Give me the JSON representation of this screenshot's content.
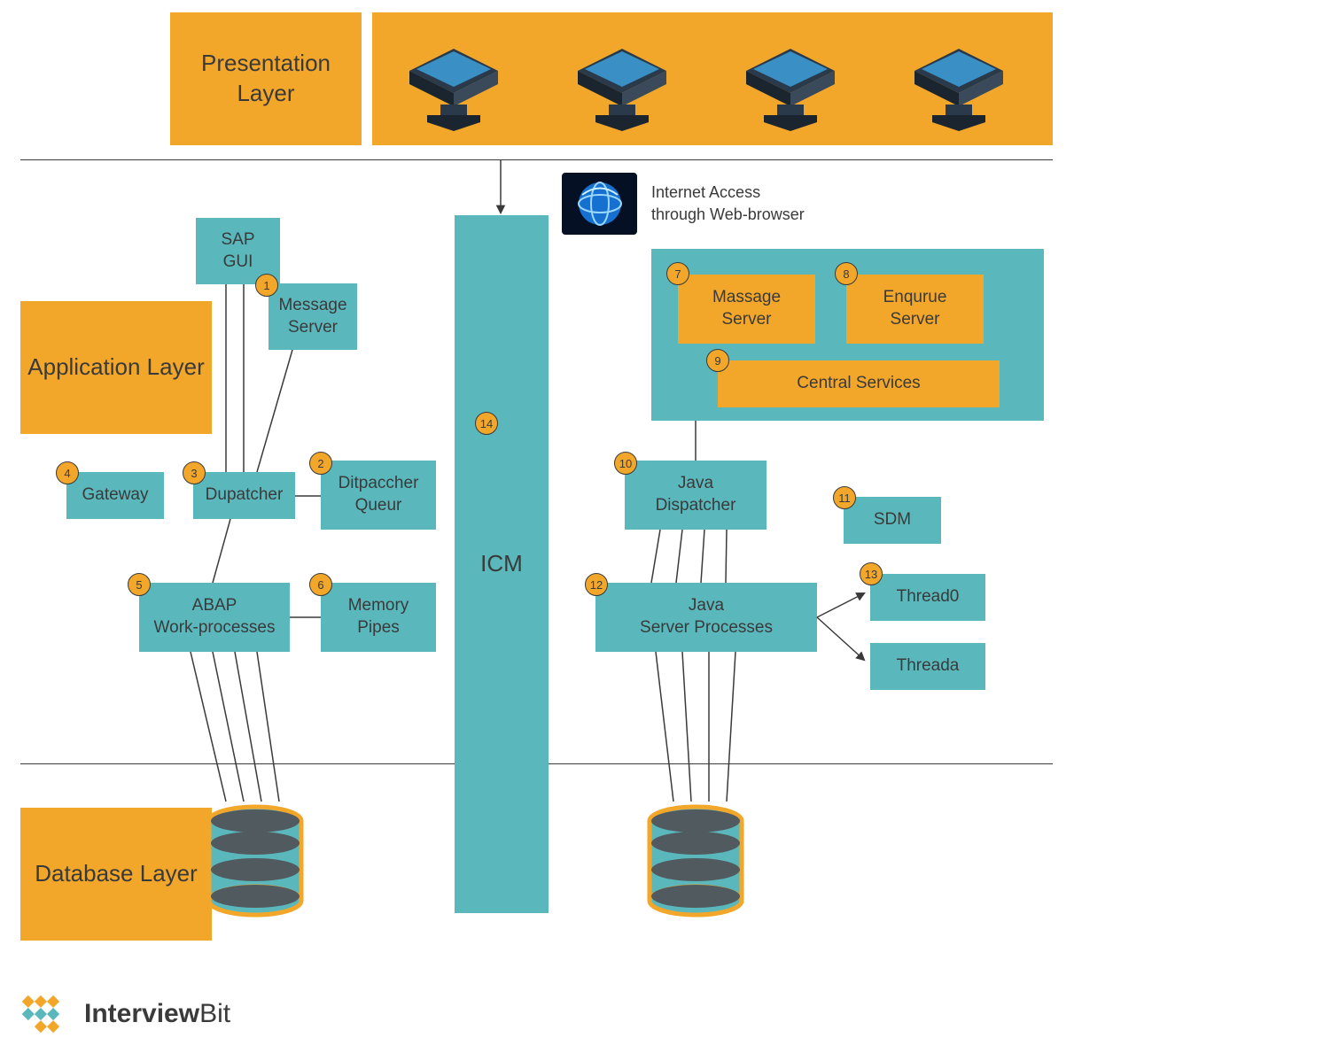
{
  "layers": {
    "presentation": "Presentation Layer",
    "application": "Application Layer",
    "database": "Database Layer"
  },
  "internet_label": "Internet Access\nthrough Web-browser",
  "nodes": {
    "sap_gui": "SAP\nGUI",
    "gateway": "Gateway",
    "message_server": "Message\nServer",
    "dupatcher": "Dupatcher",
    "ditpaccher_queur": "Ditpaccher\nQueur",
    "abap_work": "ABAP\nWork-processes",
    "memory_pipes": "Memory\nPipes",
    "massage_server": "Massage\nServer",
    "enqurue_server": "Enqurue\nServer",
    "central_services": "Central Services",
    "java_dispatcher": "Java\nDispatcher",
    "sdm": "SDM",
    "java_server_processes": "Java\nServer Processes",
    "thread0": "Thread0",
    "threada": "Threada",
    "icm": "ICM"
  },
  "badges": {
    "b1": "1",
    "b2": "2",
    "b3": "3",
    "b4": "4",
    "b5": "5",
    "b6": "6",
    "b7": "7",
    "b8": "8",
    "b9": "9",
    "b10": "10",
    "b11": "11",
    "b12": "12",
    "b13": "13",
    "b14": "14"
  },
  "brand": {
    "part1": "Interview",
    "part2": "Bit"
  }
}
